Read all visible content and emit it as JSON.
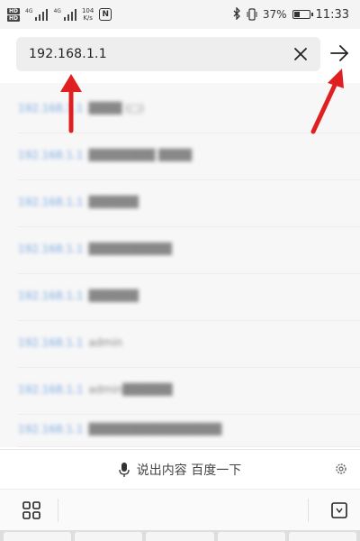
{
  "status_bar": {
    "sim1_badges": [
      "HD",
      "HD"
    ],
    "sim1_network": "4G",
    "sim2_network": "4G",
    "speed_value": "104",
    "speed_unit": "K/s",
    "nfc_label": "N",
    "battery_percent": "37%",
    "battery_level": 0.37,
    "time": "11:33",
    "icons": [
      "signal-icon",
      "nfc-icon",
      "bluetooth-icon",
      "vibrate-icon",
      "battery-icon"
    ]
  },
  "url_bar": {
    "value": "192.168.1.1",
    "clear_icon": "close-icon",
    "go_icon": "arrow-right-icon"
  },
  "suggestions": [
    {
      "ip": "192.168.1.1",
      "text": "████ (□)"
    },
    {
      "ip": "192.168.1.1",
      "text": "████████ ████"
    },
    {
      "ip": "192.168.1.1",
      "text": "██████"
    },
    {
      "ip": "192.168.1.1",
      "text": "██████████"
    },
    {
      "ip": "192.168.1.1",
      "text": "██████"
    },
    {
      "ip": "192.168.1.1",
      "text": "admin"
    },
    {
      "ip": "192.168.1.1",
      "text": "admin██████"
    },
    {
      "ip": "192.168.1.1",
      "text": "████████████████"
    }
  ],
  "voice_bar": {
    "label": "说出内容 百度一下",
    "mic_icon": "microphone-icon",
    "settings_icon": "gear-icon"
  },
  "keyboard": {
    "left_icon": "grid-icon",
    "right_icon": "keyboard-hide-icon"
  },
  "colors": {
    "status_bg": "#f4f4f4",
    "url_field_bg": "#eeeeee",
    "suggestion_bg": "#f7f7f7",
    "blur_ip_color": "#7aa7e0",
    "annotation_red": "#e02020"
  }
}
